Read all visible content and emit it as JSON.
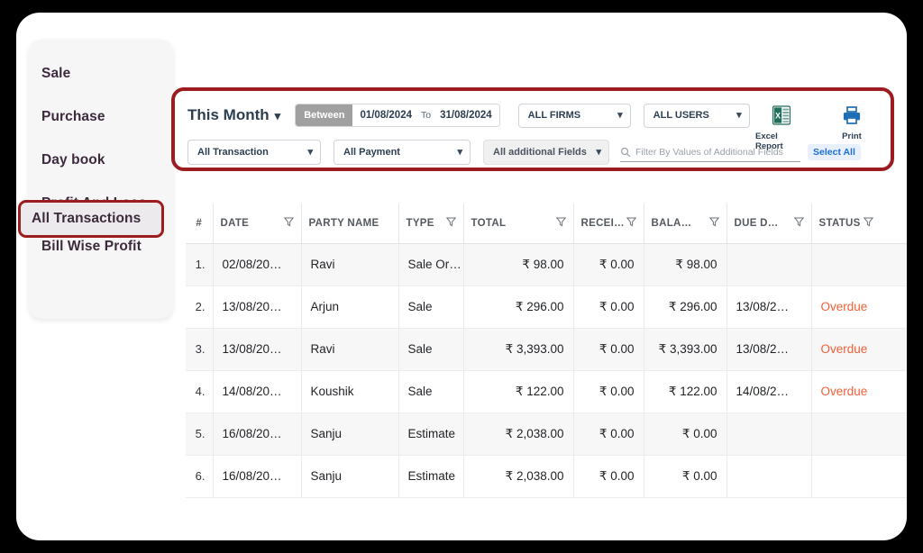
{
  "sidebar": {
    "items": [
      {
        "label": "Sale",
        "active": false
      },
      {
        "label": "Purchase",
        "active": false
      },
      {
        "label": "Day book",
        "active": false
      },
      {
        "label": "All Transactions",
        "active": true
      },
      {
        "label": "Profit And Loss",
        "active": false
      },
      {
        "label": "Bill Wise Profit",
        "active": false
      }
    ]
  },
  "toolbar": {
    "period_label": "This Month",
    "between_label": "Between",
    "date_from": "01/08/2024",
    "date_to_label": "To",
    "date_to": "31/08/2024",
    "firms_select": "ALL FIRMS",
    "users_select": "ALL USERS",
    "transaction_select": "All Transaction",
    "payment_select": "All Payment",
    "additional_fields_select": "All additional Fields",
    "search_placeholder": "Filter By Values of Additional Fields",
    "search_value": "",
    "select_all_label": "Select All",
    "excel_label": "Excel Report",
    "print_label": "Print"
  },
  "table": {
    "columns": [
      {
        "key": "idx",
        "label": "#",
        "filter": false
      },
      {
        "key": "date",
        "label": "DATE",
        "filter": true
      },
      {
        "key": "party",
        "label": "PARTY NAME",
        "filter": false
      },
      {
        "key": "type",
        "label": "TYPE",
        "filter": true
      },
      {
        "key": "total",
        "label": "TOTAL",
        "filter": true
      },
      {
        "key": "receive",
        "label": "RECEI…",
        "filter": true
      },
      {
        "key": "balance",
        "label": "BALA…",
        "filter": true
      },
      {
        "key": "duedate",
        "label": "DUE D…",
        "filter": true
      },
      {
        "key": "status",
        "label": "STATUS",
        "filter": true
      }
    ],
    "rows": [
      {
        "idx": "1.",
        "date": "02/08/20…",
        "party": "Ravi",
        "type": "Sale Or…",
        "total": "₹ 98.00",
        "receive": "₹ 0.00",
        "balance": "₹ 98.00",
        "duedate": "",
        "status": ""
      },
      {
        "idx": "2.",
        "date": "13/08/20…",
        "party": "Arjun",
        "type": "Sale",
        "total": "₹ 296.00",
        "receive": "₹ 0.00",
        "balance": "₹ 296.00",
        "duedate": "13/08/2…",
        "status": "Overdue"
      },
      {
        "idx": "3.",
        "date": "13/08/20…",
        "party": "Ravi",
        "type": "Sale",
        "total": "₹ 3,393.00",
        "receive": "₹ 0.00",
        "balance": "₹ 3,393.00",
        "duedate": "13/08/2…",
        "status": "Overdue"
      },
      {
        "idx": "4.",
        "date": "14/08/20…",
        "party": "Koushik",
        "type": "Sale",
        "total": "₹ 122.00",
        "receive": "₹ 0.00",
        "balance": "₹ 122.00",
        "duedate": "14/08/2…",
        "status": "Overdue"
      },
      {
        "idx": "5.",
        "date": "16/08/20…",
        "party": "Sanju",
        "type": "Estimate",
        "total": "₹ 2,038.00",
        "receive": "₹ 0.00",
        "balance": "₹ 0.00",
        "duedate": "",
        "status": ""
      },
      {
        "idx": "6.",
        "date": "16/08/20…",
        "party": "Sanju",
        "type": "Estimate",
        "total": "₹ 2,038.00",
        "receive": "₹ 0.00",
        "balance": "₹ 0.00",
        "duedate": "",
        "status": ""
      }
    ]
  },
  "colors": {
    "highlight_border": "#9c1d20",
    "status_overdue": "#ef6136",
    "accent_link": "#1b6fd6",
    "heading": "#2c3e52"
  }
}
